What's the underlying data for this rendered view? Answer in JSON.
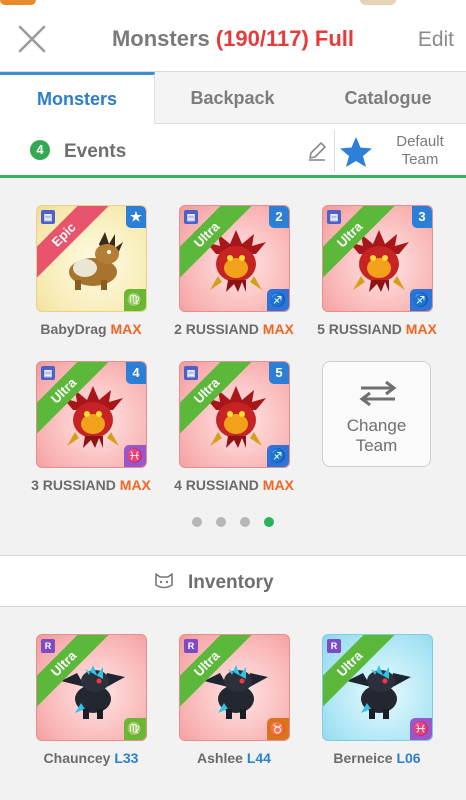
{
  "header": {
    "title": "Monsters",
    "count": "(190/117) Full",
    "edit_label": "Edit"
  },
  "tabs": [
    {
      "label": "Monsters",
      "active": true
    },
    {
      "label": "Backpack",
      "active": false
    },
    {
      "label": "Catalogue",
      "active": false
    }
  ],
  "events": {
    "badge": "4",
    "label": "Events",
    "default_team_line1": "Default",
    "default_team_line2": "Team"
  },
  "team": [
    {
      "name": "BabyDrag",
      "suffix": "MAX",
      "rarity": "Epic",
      "slot": "",
      "slot_icon": "star-icon",
      "element": "virgo-icon",
      "element_glyph": "♍",
      "background": "yellow"
    },
    {
      "name": "2 RUSSIAND",
      "suffix": "MAX",
      "rarity": "Ultra",
      "slot": "2",
      "element": "sagittarius-icon",
      "element_glyph": "♐",
      "background": "pink"
    },
    {
      "name": "5 RUSSIAND",
      "suffix": "MAX",
      "rarity": "Ultra",
      "slot": "3",
      "element": "sagittarius-icon",
      "element_glyph": "♐",
      "background": "pink"
    },
    {
      "name": "3 RUSSIAND",
      "suffix": "MAX",
      "rarity": "Ultra",
      "slot": "4",
      "element": "pisces-icon",
      "element_glyph": "♓",
      "background": "pink"
    },
    {
      "name": "4 RUSSIAND",
      "suffix": "MAX",
      "rarity": "Ultra",
      "slot": "5",
      "element": "sagittarius-icon",
      "element_glyph": "♐",
      "background": "pink"
    }
  ],
  "change_team": {
    "line1": "Change",
    "line2": "Team"
  },
  "pager": {
    "count": 4,
    "active_index": 3
  },
  "inventory": {
    "label": "Inventory",
    "items": [
      {
        "name": "Chauncey",
        "level": "L33",
        "rarity": "Ultra",
        "rank": "R",
        "element": "virgo-icon",
        "element_glyph": "♍",
        "background": "pink"
      },
      {
        "name": "Ashlee",
        "level": "L44",
        "rarity": "Ultra",
        "rank": "R",
        "element": "taurus-icon",
        "element_glyph": "♉",
        "background": "pink"
      },
      {
        "name": "Berneice",
        "level": "L06",
        "rarity": "Ultra",
        "rank": "R",
        "element": "pisces-icon",
        "element_glyph": "♓",
        "background": "blue"
      }
    ]
  },
  "colors": {
    "accent_blue": "#2a7fc8",
    "count_red": "#e63b3b",
    "max_orange": "#f26522",
    "events_green": "#36b25a"
  }
}
